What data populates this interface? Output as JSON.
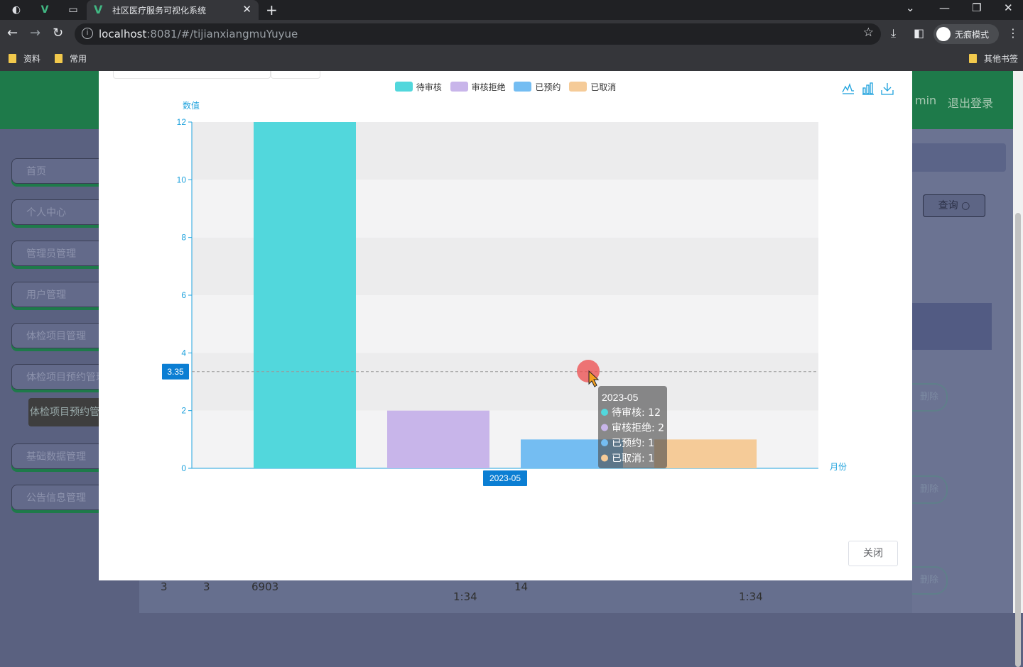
{
  "browser": {
    "tab_title": "社区医疗服务可视化系统",
    "url_host": "localhost",
    "url_rest": ":8081/#/tijianxiangmuYuyue",
    "incognito_label": "无痕模式",
    "bookmarks": [
      "资料",
      "常用"
    ],
    "other_bookmarks": "其他书签"
  },
  "app": {
    "header_right": [
      "min",
      "退出登录"
    ],
    "sidebar_items": [
      "首页",
      "个人中心",
      "管理员管理",
      "用户管理",
      "体检项目管理",
      "体检项目预约管理",
      "基础数据管理",
      "公告信息管理"
    ],
    "sidebar_subitem": "体检项目预约管理",
    "query_button": "查询",
    "delete_label": "删除",
    "bottom_row": [
      "3",
      "3",
      "6903",
      "14",
      "1:34",
      "1:34"
    ]
  },
  "modal": {
    "close_button": "关闭"
  },
  "chart_data": {
    "type": "bar",
    "categories": [
      "2023-05"
    ],
    "series": [
      {
        "name": "待审核",
        "values": [
          12
        ],
        "color": "#52d7dc"
      },
      {
        "name": "审核拒绝",
        "values": [
          2
        ],
        "color": "#c8b5ea"
      },
      {
        "name": "已预约",
        "values": [
          1
        ],
        "color": "#74bdf2"
      },
      {
        "name": "已取消",
        "values": [
          1
        ],
        "color": "#f5cb98"
      }
    ],
    "ylabel": "数值",
    "xlabel": "月份",
    "ylim": [
      0,
      12
    ],
    "yticks": [
      0,
      2,
      4,
      6,
      8,
      10,
      12
    ],
    "grid": "split-area",
    "legend_position": "top",
    "axis_pointer": {
      "y_value": 3.35,
      "y_label": "3.35",
      "x_label": "2023-05"
    },
    "tooltip": {
      "title": "2023-05",
      "lines": [
        "待审核: 12",
        "审核拒绝: 2",
        "已预约: 1",
        "已取消: 1"
      ]
    },
    "toolbox_icons": [
      "line-chart-icon",
      "bar-chart-icon",
      "download-icon"
    ]
  }
}
